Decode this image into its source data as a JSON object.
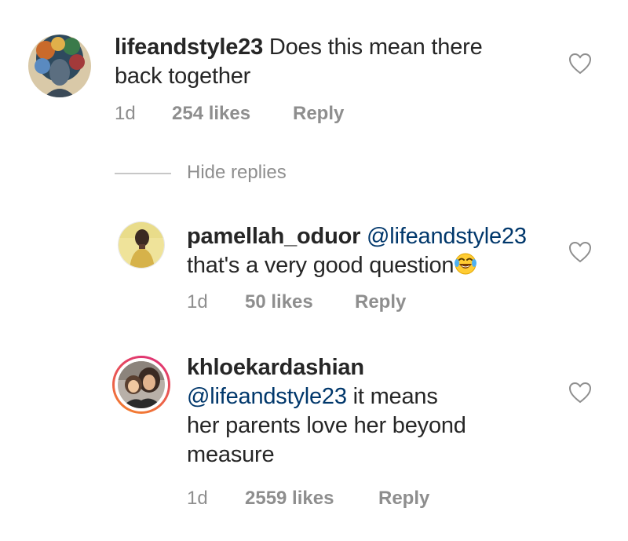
{
  "comments": [
    {
      "username": "lifeandstyle23",
      "mention": "",
      "text_lines": [
        "Does this mean there",
        "back together"
      ],
      "time": "1d",
      "likes": "254 likes",
      "reply_label": "Reply",
      "avatar_icon": "profile-photo-colorful-hair"
    },
    {
      "username": "pamellah_oduor",
      "mention": "@lifeandstyle23",
      "text": "that's a very good question",
      "emoji": "face-with-tears-of-joy",
      "time": "1d",
      "likes": "50 likes",
      "reply_label": "Reply",
      "avatar_icon": "profile-photo-person"
    },
    {
      "username": "khloekardashian",
      "mention": "@lifeandstyle23",
      "text_lines": [
        "it means",
        "her parents love her beyond",
        "measure"
      ],
      "time": "1d",
      "likes": "2559 likes",
      "reply_label": "Reply",
      "avatar_icon": "profile-photo-story-ring"
    }
  ],
  "thread": {
    "hide_replies_label": "Hide replies"
  },
  "icons": {
    "like": "heart-outline-icon"
  },
  "colors": {
    "text": "#262626",
    "meta": "#8e8e8e",
    "mention": "#00376b",
    "story_ring_start": "#f58529",
    "story_ring_end": "#dd2a7b"
  }
}
